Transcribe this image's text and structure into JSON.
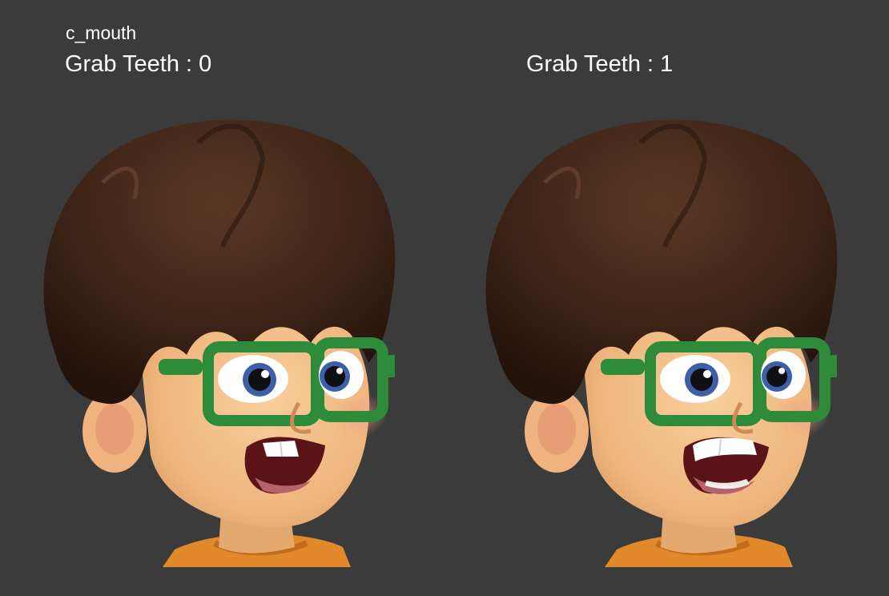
{
  "viewer": {
    "control_name": "c_mouth"
  },
  "panels": [
    {
      "label": "Grab Teeth : 0",
      "attribute": "Grab Teeth",
      "value": 0,
      "image": "character-head-render"
    },
    {
      "label": "Grab Teeth : 1",
      "attribute": "Grab Teeth",
      "value": 1,
      "image": "character-head-render"
    }
  ],
  "colors": {
    "background": "#3b3b3b",
    "text": "#ffffff",
    "hair": "#3e2416",
    "skin": "#f3c48e",
    "glasses": "#2e8b3a",
    "shirt": "#e28a2b",
    "iris": "#3d5fa8"
  }
}
